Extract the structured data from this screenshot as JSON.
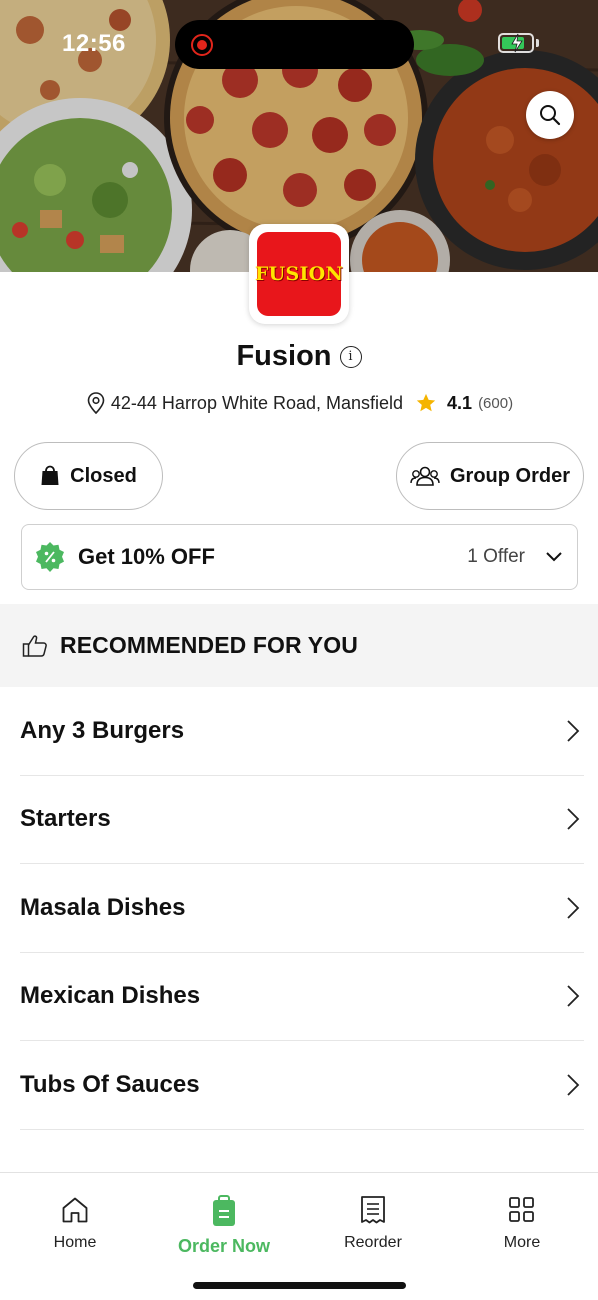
{
  "status_bar": {
    "time": "12:56",
    "battery_percent": 80
  },
  "store": {
    "name": "Fusion",
    "logo_text": "FUSION",
    "address": "42-44 Harrop White Road, Mansfield",
    "rating": "4.1",
    "rating_count": "(600)"
  },
  "actions": {
    "status_label": "Closed",
    "group_order_label": "Group Order"
  },
  "offer": {
    "title": "Get 10% OFF",
    "count_label": "1 Offer"
  },
  "section": {
    "title": "RECOMMENDED FOR YOU"
  },
  "categories": [
    {
      "label": "Any 3 Burgers"
    },
    {
      "label": "Starters"
    },
    {
      "label": "Masala Dishes"
    },
    {
      "label": "Mexican Dishes"
    },
    {
      "label": "Tubs Of Sauces"
    }
  ],
  "nav": {
    "items": [
      {
        "label": "Home",
        "icon": "home-icon"
      },
      {
        "label": "Order Now",
        "icon": "order-bag-icon"
      },
      {
        "label": "Reorder",
        "icon": "receipt-icon"
      },
      {
        "label": "More",
        "icon": "grid-icon"
      }
    ],
    "active_index": 1
  },
  "colors": {
    "accent_green": "#4cb860",
    "star": "#f5b400",
    "logo_red": "#e8161b",
    "logo_text": "#ffe500",
    "record_red": "#e1251b"
  }
}
